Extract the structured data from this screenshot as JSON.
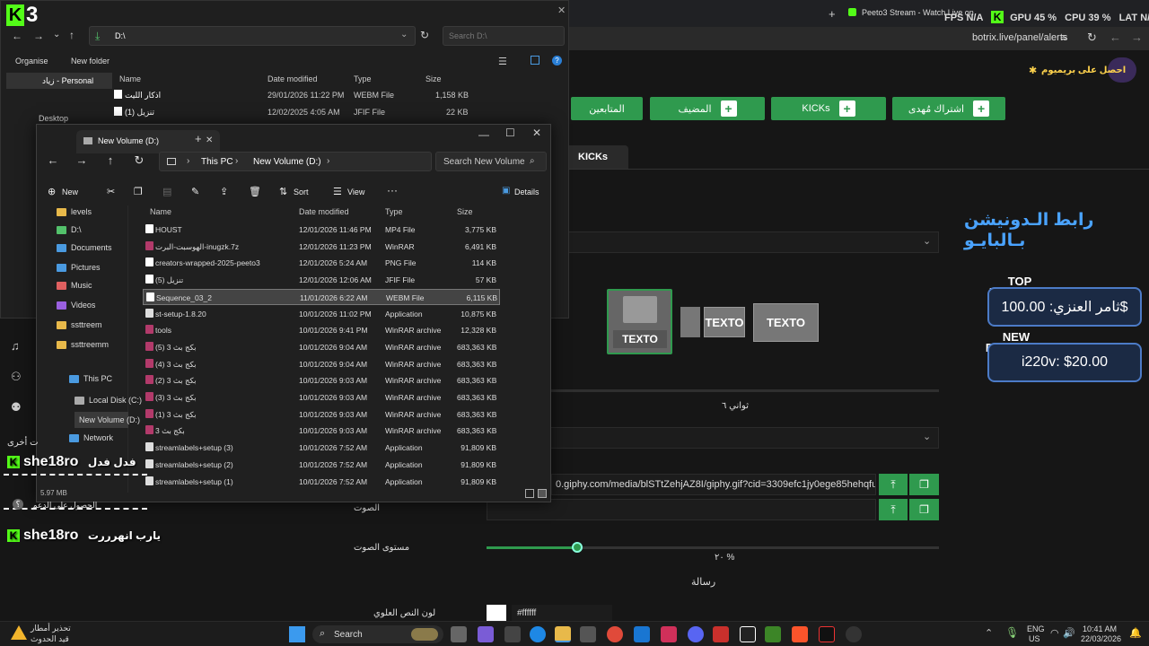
{
  "browser": {
    "tab_title": "Peeto3 Stream - Watch Live on",
    "url": "botrix.live/panel/alerts"
  },
  "overlay": {
    "logo": "3",
    "fps": "FPS N/A",
    "gpu": "GPU 45 %",
    "cpu": "CPU 39 %",
    "lat": "LAT N/A"
  },
  "panel": {
    "premium_link": "احصل على بريميوم",
    "buttons": [
      {
        "label": "المتابعين"
      },
      {
        "label": "المضيف"
      },
      {
        "label": "KICKs"
      },
      {
        "label": "اشتراك مُهدى"
      }
    ],
    "active_tab": "KICKs",
    "donation_title": "رابط الـدونيشن بـالبايـو",
    "card_labels": [
      "TEXTO",
      "TEXTO",
      "TEXTO"
    ],
    "duration": "ثواني ٦",
    "gif_url": "0.giphy.com/media/blSTtZehjAZ8I/giphy.gif?cid=3309efc1jy0ege85hehqfup:",
    "sound_label": "الصوت",
    "volume_label": "مستوى الصوت",
    "volume_value": "٢٠ %",
    "volume": 0.2,
    "message_label": "رسالة",
    "top_color_label": "لون النص العلوي",
    "color_value": "#ffffff",
    "top_donation_label": "TOP DONATION",
    "top_donation_value": "ثامر العنزي: 100.00$",
    "new_donation_label": "NEW DONATION",
    "new_donation_value": "i220v: $20.00"
  },
  "explorer_back": {
    "path": "D:\\",
    "search_placeholder": "Search D:\\",
    "organise": "Organise",
    "new_folder": "New folder",
    "columns": [
      "Name",
      "Date modified",
      "Type",
      "Size"
    ],
    "sidebar": [
      "زياد - Personal",
      "Desktop"
    ],
    "rows": [
      {
        "name": "اذكار الليت",
        "date": "29/01/2026 11:22 PM",
        "type": "WEBM File",
        "size": "1,158 KB"
      },
      {
        "name": "تنزيل (1)",
        "date": "12/02/2025 4:05 AM",
        "type": "JFIF File",
        "size": "22 KB"
      }
    ]
  },
  "explorer": {
    "tab_title": "New Volume (D:)",
    "breadcrumb": [
      "This PC",
      "New Volume (D:)"
    ],
    "search_placeholder": "Search New Volume",
    "toolbar": {
      "new": "New",
      "sort": "Sort",
      "view": "View",
      "details": "Details"
    },
    "columns": [
      "Name",
      "Date modified",
      "Type",
      "Size"
    ],
    "sidebar": [
      {
        "label": "levels"
      },
      {
        "label": "D:\\"
      },
      {
        "label": "Documents"
      },
      {
        "label": "Pictures"
      },
      {
        "label": "Music"
      },
      {
        "label": "Videos"
      },
      {
        "label": "ssttreem"
      },
      {
        "label": "ssttreemm"
      },
      {
        "label": "This PC"
      },
      {
        "label": "Local Disk (C:)"
      },
      {
        "label": "New Volume (D:)"
      },
      {
        "label": "Network"
      }
    ],
    "rows": [
      {
        "name": "HOUST",
        "date": "12/01/2026 11:46 PM",
        "type": "MP4 File",
        "size": "3,775 KB"
      },
      {
        "name": "الهوسبت-البرت-inugzk.7z",
        "date": "12/01/2026 11:23 PM",
        "type": "WinRAR",
        "size": "6,491 KB"
      },
      {
        "name": "creators-wrapped-2025-peeto3",
        "date": "12/01/2026 5:24 AM",
        "type": "PNG File",
        "size": "114 KB"
      },
      {
        "name": "تنزيل (5)",
        "date": "12/01/2026 12:06 AM",
        "type": "JFIF File",
        "size": "57 KB"
      },
      {
        "name": "Sequence_03_2",
        "date": "11/01/2026 6:22 AM",
        "type": "WEBM File",
        "size": "6,115 KB"
      },
      {
        "name": "st-setup-1.8.20",
        "date": "10/01/2026 11:02 PM",
        "type": "Application",
        "size": "10,875 KB"
      },
      {
        "name": "tools",
        "date": "10/01/2026 9:41 PM",
        "type": "WinRAR archive",
        "size": "12,328 KB"
      },
      {
        "name": "بكج بث 3 (5)",
        "date": "10/01/2026 9:04 AM",
        "type": "WinRAR archive",
        "size": "683,363 KB"
      },
      {
        "name": "بكج بث 3 (4)",
        "date": "10/01/2026 9:04 AM",
        "type": "WinRAR archive",
        "size": "683,363 KB"
      },
      {
        "name": "بكج بث 3 (2)",
        "date": "10/01/2026 9:03 AM",
        "type": "WinRAR archive",
        "size": "683,363 KB"
      },
      {
        "name": "بكج بث 3 (3)",
        "date": "10/01/2026 9:03 AM",
        "type": "WinRAR archive",
        "size": "683,363 KB"
      },
      {
        "name": "بكج بث 3 (1)",
        "date": "10/01/2026 9:03 AM",
        "type": "WinRAR archive",
        "size": "683,363 KB"
      },
      {
        "name": "بكج بث 3",
        "date": "10/01/2026 9:03 AM",
        "type": "WinRAR archive",
        "size": "683,363 KB"
      },
      {
        "name": "streamlabels+setup (3)",
        "date": "10/01/2026 7:52 AM",
        "type": "Application",
        "size": "91,809 KB"
      },
      {
        "name": "streamlabels+setup (2)",
        "date": "10/01/2026 7:52 AM",
        "type": "Application",
        "size": "91,809 KB"
      },
      {
        "name": "streamlabels+setup (1)",
        "date": "10/01/2026 7:52 AM",
        "type": "Application",
        "size": "91,809 KB"
      }
    ],
    "status": "5.97 MB"
  },
  "chat": [
    {
      "user": "she18ro",
      "msg": "فدل فدل"
    },
    {
      "user": "she18ro",
      "msg": "يارب انهرررت"
    }
  ],
  "chat_extra": [
    "ت أخرى",
    "الحصول على الدعم",
    "؟"
  ],
  "taskbar": {
    "weather_title": "تحذير أمطار",
    "weather_sub": "قيد الحدوث",
    "search": "Search",
    "lang": "ENG",
    "lang_region": "US",
    "time": "10:41 AM",
    "date": "22/03/2026"
  }
}
